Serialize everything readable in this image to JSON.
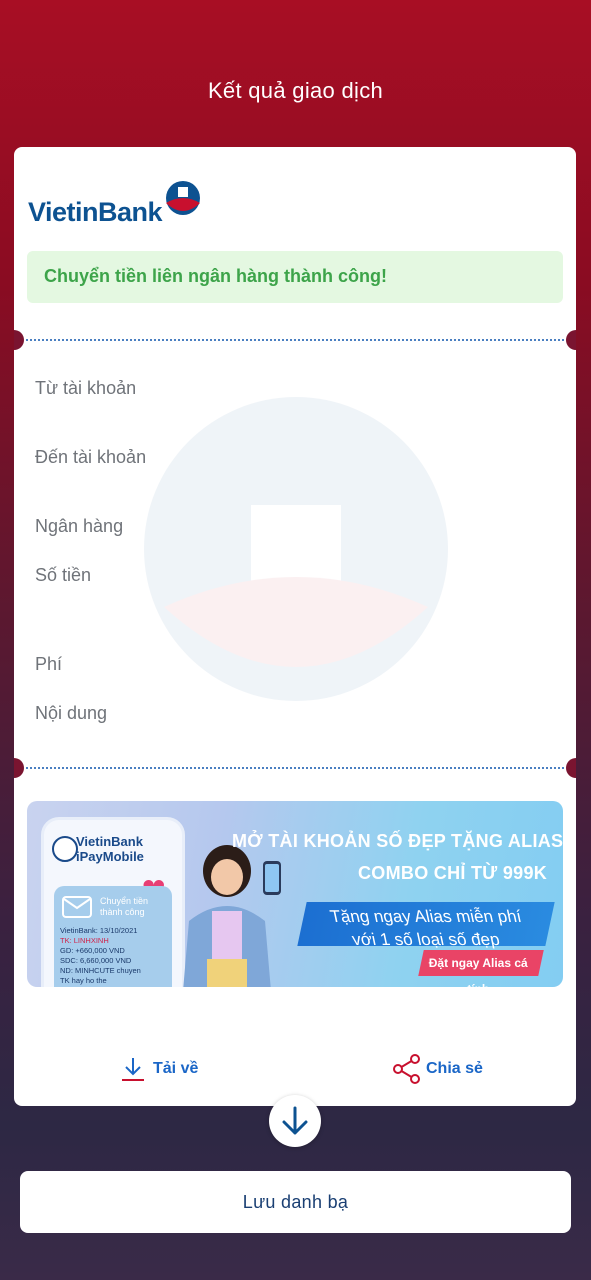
{
  "header": {
    "title": "Kết quả giao dịch"
  },
  "brand": {
    "name": "VietinBank"
  },
  "status": {
    "message": "Chuyển tiền liên ngân hàng thành công!"
  },
  "details": {
    "labels": [
      "Từ tài khoản",
      "Đến tài khoản",
      "Ngân hàng",
      "Số tiền",
      "Phí",
      "Nội dung"
    ]
  },
  "banner": {
    "app_name_line1": "VietinBank",
    "app_name_line2": "iPayMobile",
    "notification_line1": "Chuyển tiền",
    "notification_line2": "thành công",
    "sms_lines": [
      "VietinBank: 13/10/2021",
      "TK: LINHXINH",
      "GD: +660,000 VND",
      "SDC: 6,660,000 VND",
      "ND: MINHCUTE chuyen",
      "TK hay ho the"
    ],
    "headline1": "MỞ TÀI KHOẢN SỐ ĐẸP TẶNG ALIAS",
    "headline2": "COMBO CHỈ TỪ 999K",
    "offer_line1": "Tặng ngay Alias miễn phí",
    "offer_line2": "với 1 số loại số đẹp",
    "cta": "Đặt ngay Alias cá tính"
  },
  "actions": {
    "download_label": "Tải về",
    "share_label": "Chia sẻ"
  },
  "footer": {
    "save_contact_label": "Lưu danh bạ"
  },
  "colors": {
    "brand_blue": "#0d5291",
    "brand_red": "#c8102e",
    "success_green": "#3da44a",
    "link_blue": "#1a66c7"
  }
}
